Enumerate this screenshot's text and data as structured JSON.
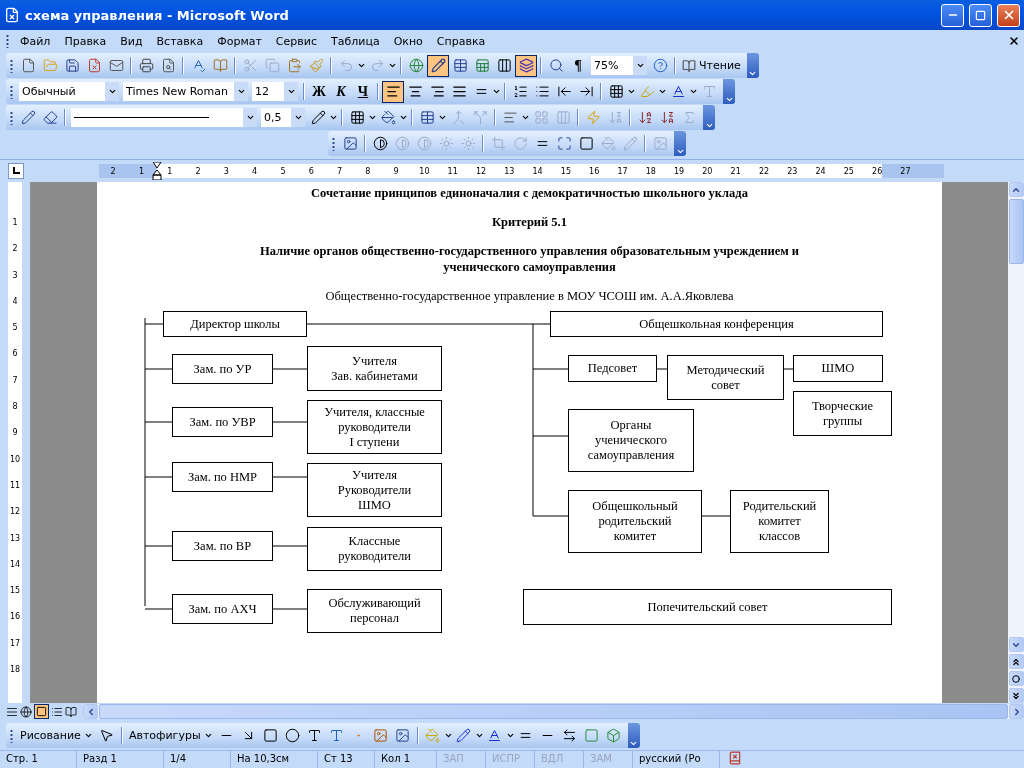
{
  "window": {
    "title": "схема управления - Microsoft Word"
  },
  "menu": [
    {
      "label": "Файл"
    },
    {
      "label": "Правка"
    },
    {
      "label": "Вид"
    },
    {
      "label": "Вставка"
    },
    {
      "label": "Формат"
    },
    {
      "label": "Сервис"
    },
    {
      "label": "Таблица"
    },
    {
      "label": "Окно"
    },
    {
      "label": "Справка"
    }
  ],
  "standard_toolbar": {
    "tables_borders_pressed": true,
    "drawing_pressed": true,
    "pilcrow": "¶",
    "zoom": "75%",
    "reading": "Чтение"
  },
  "formatting_toolbar": {
    "style": "Обычный",
    "font": "Times New Roman",
    "size": "12",
    "bold": "Ж",
    "italic": "К",
    "underline": "Ч",
    "alignment": [
      {
        "selected": true
      },
      {
        "selected": false
      },
      {
        "selected": false
      },
      {
        "selected": false
      }
    ]
  },
  "tables_toolbar": {
    "line_weight": "0,5"
  },
  "ruler": {
    "left_marks": [
      "2",
      "1"
    ],
    "marks": [
      "1",
      "2",
      "3",
      "4",
      "5",
      "6",
      "7",
      "8",
      "9",
      "10",
      "11",
      "12",
      "13",
      "14",
      "15",
      "16",
      "17",
      "18",
      "19",
      "20",
      "21",
      "22",
      "23",
      "24",
      "25",
      "26",
      "27"
    ]
  },
  "vertical_ruler": {
    "marks": [
      "1",
      "2",
      "3",
      "4",
      "5",
      "6",
      "7",
      "8",
      "9",
      "10",
      "11",
      "12",
      "13",
      "14",
      "15",
      "16",
      "17",
      "18"
    ]
  },
  "document": {
    "headings": [
      {
        "text": "Сочетание принципов единоначалия с демократичностью школьного уклада",
        "bold": true
      },
      {
        "text": "Критерий 5.1",
        "bold": true
      },
      {
        "text": "Наличие органов общественно-государственного управления образовательным учреждением и ученического самоуправления",
        "bold": true
      },
      {
        "text": "Общественно-государственное управление в МОУ ЧСОШ им. А.А.Яковлева",
        "bold": false
      }
    ],
    "diagram": {
      "nodes": [
        {
          "text": "Директор школы"
        },
        {
          "text": "Общешкольная конференция"
        },
        {
          "text": "Зам. по УР"
        },
        {
          "text": "Учителя\nЗав. кабинетами"
        },
        {
          "text": "Зам. по УВР"
        },
        {
          "text": "Учителя, классные\nруководители\nI ступени"
        },
        {
          "text": "Зам. по НМР"
        },
        {
          "text": "Учителя\nРуководители\nШМО"
        },
        {
          "text": "Зам. по ВР"
        },
        {
          "text": "Классные\nруководители"
        },
        {
          "text": "Зам. по АХЧ"
        },
        {
          "text": "Обслуживающий\nперсонал"
        },
        {
          "text": "Педсовет"
        },
        {
          "text": "Методический\nсовет"
        },
        {
          "text": "ШМО"
        },
        {
          "text": "Творческие\nгруппы"
        },
        {
          "text": "Органы\nученического\nсамоуправления"
        },
        {
          "text": "Общешкольный\nродительский\nкомитет"
        },
        {
          "text": "Родительский\nкомитет\nклассов"
        },
        {
          "text": "Попечительский совет"
        }
      ]
    }
  },
  "drawing_toolbar": {
    "draw_menu": "Рисование",
    "autoshapes": "Автофигуры"
  },
  "status_bar": {
    "fields": [
      {
        "text": "Стр. 1",
        "disabled": false
      },
      {
        "text": "Разд 1",
        "disabled": false
      },
      {
        "text": "1/4",
        "disabled": false
      },
      {
        "text": "На 10,3см",
        "disabled": false
      },
      {
        "text": "Ст 13",
        "disabled": false
      },
      {
        "text": "Кол 1",
        "disabled": false
      },
      {
        "text": "ЗАП",
        "disabled": true
      },
      {
        "text": "ИСПР",
        "disabled": true
      },
      {
        "text": "ВДЛ",
        "disabled": true
      },
      {
        "text": "ЗАМ",
        "disabled": true
      },
      {
        "text": "русский (Ро",
        "disabled": false
      }
    ]
  }
}
